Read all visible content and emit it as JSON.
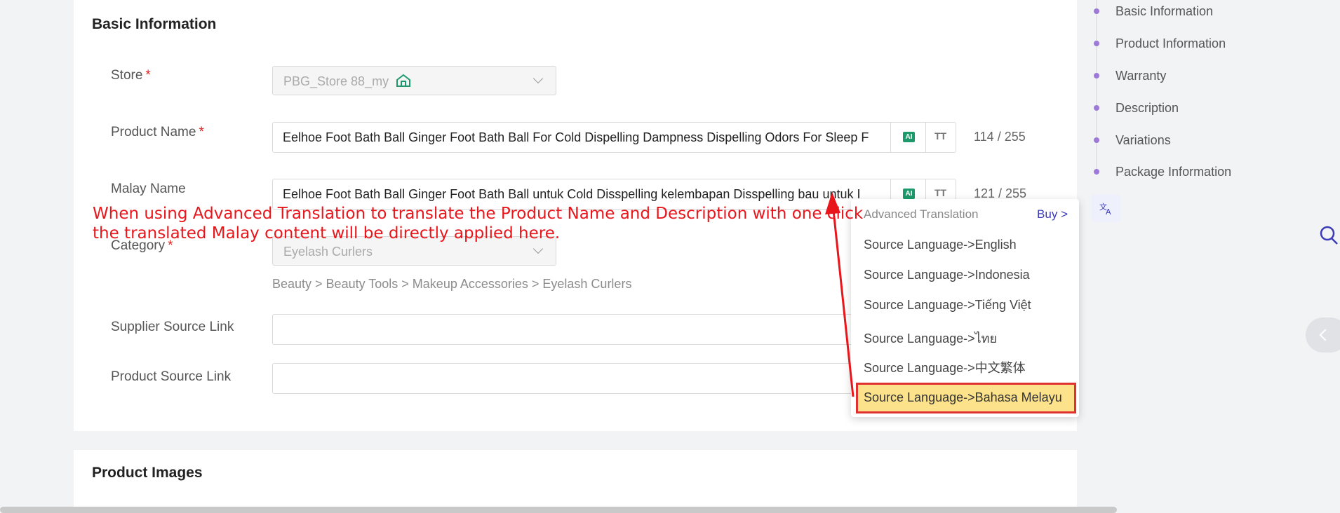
{
  "basic_section": {
    "title": "Basic Information",
    "store": {
      "label": "Store",
      "required_mark": "*",
      "value": "PBG_Store 88_my"
    },
    "product_name": {
      "label": "Product Name",
      "required_mark": "*",
      "value": "Eelhoe Foot Bath Ball Ginger Foot Bath Ball For Cold Dispelling Dampness Dispelling Odors For Sleep F",
      "counter": "114 / 255",
      "ai_label": "AI"
    },
    "malay_name": {
      "label": "Malay Name",
      "value": "Eelhoe Foot Bath Ball Ginger Foot Bath Ball untuk Cold Disspelling kelembapan Disspelling bau untuk I",
      "counter": "121 / 255",
      "ai_label": "AI"
    },
    "category": {
      "label": "Category",
      "required_mark": "*",
      "value": "Eyelash Curlers",
      "breadcrumb": "Beauty > Beauty Tools > Makeup Accessories > Eyelash Curlers"
    },
    "supplier_link": {
      "label": "Supplier Source Link",
      "value": ""
    },
    "product_link": {
      "label": "Product Source Link",
      "value": ""
    }
  },
  "images_section": {
    "title": "Product Images"
  },
  "anchor_nav": {
    "items": [
      "Basic Information",
      "Product Information",
      "Warranty",
      "Description",
      "Variations",
      "Package Information"
    ]
  },
  "translation_menu": {
    "header": "Advanced Translation",
    "buy": "Buy >",
    "items": [
      "Source Language->English",
      "Source Language->Indonesia",
      "Source Language->Tiếng Việt",
      "Source Language->ไทย",
      "Source Language->中文繁体",
      "Source Language->Bahasa Melayu"
    ]
  },
  "annotation": {
    "line1": "When using Advanced Translation to translate the Product Name and Description with one click",
    "line2": "the translated Malay content will be directly applied here."
  },
  "icons": {
    "store": "store-icon",
    "translate": "translate-icon",
    "search": "search-icon",
    "collapse": "chevron-left-icon",
    "text_format": "text-format-icon"
  },
  "colors": {
    "accent": "#9e7ad8",
    "annotation": "#e8161b",
    "highlight": "#fde28c",
    "ai": "#1d9a6c"
  }
}
